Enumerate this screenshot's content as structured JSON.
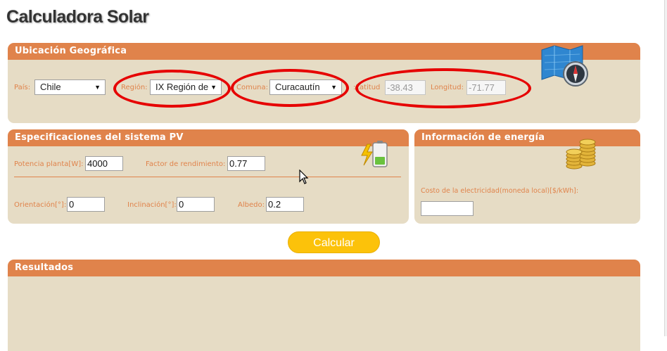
{
  "page": {
    "title": "Calculadora Solar"
  },
  "ubicacion": {
    "header": "Ubicación Geográfica",
    "pais_label": "País:",
    "pais_value": "Chile",
    "region_label": "Región:",
    "region_value": "IX Región de",
    "comuna_label": "Comuna:",
    "comuna_value": "Curacautín",
    "latitud_label": "Latitud:",
    "latitud_value": "-38.43",
    "longitud_label": "Longitud:",
    "longitud_value": "-71.77",
    "icon": "map-compass-icon"
  },
  "sistema_pv": {
    "header": "Especificaciones del sistema PV",
    "potencia_label": "Potencia planta[W]:",
    "potencia_value": "4000",
    "factor_label": "Factor de rendimiento:",
    "factor_value": "0.77",
    "orientacion_label": "Orientación[°]:",
    "orientacion_value": "0",
    "inclinacion_label": "Inclinación[°]:",
    "inclinacion_value": "0",
    "albedo_label": "Albedo:",
    "albedo_value": "0.2",
    "icon": "battery-charging-icon"
  },
  "energia": {
    "header": "Información de energía",
    "costo_label": "Costo de la electricidad(moneda local)[$/kWh]:",
    "costo_value": "",
    "icon": "coins-icon"
  },
  "actions": {
    "calcular_label": "Calcular"
  },
  "resultados": {
    "header": "Resultados"
  },
  "colors": {
    "accent": "#e0834b",
    "panel_bg": "#e6dcc5",
    "button": "#fcc20a",
    "annotation": "#e60000"
  }
}
